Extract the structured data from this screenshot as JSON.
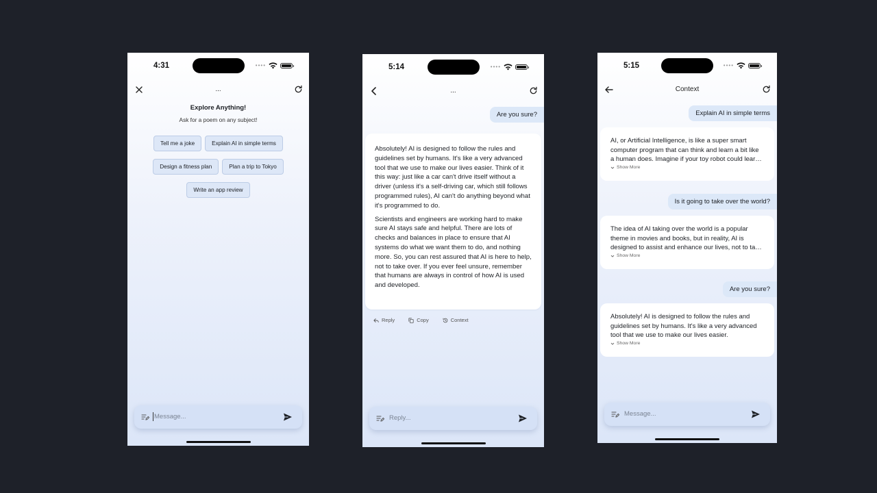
{
  "phone1": {
    "status": {
      "time": "4:31"
    },
    "nav": {
      "title": "..."
    },
    "title": "Explore Anything!",
    "subtitle": "Ask for a poem on any subject!",
    "suggestions": [
      "Tell me a joke",
      "Explain AI in simple terms",
      "Design a fitness plan",
      "Plan a trip to Tokyo",
      "Write an app review"
    ],
    "input": {
      "placeholder": "Message..."
    }
  },
  "phone2": {
    "status": {
      "time": "5:14"
    },
    "nav": {
      "title": "..."
    },
    "user_message": "Are you sure?",
    "assistant_paragraphs": [
      "Absolutely! AI is designed to follow the rules and guidelines set by humans. It's like a very advanced tool that we use to make our lives easier. Think of it this way: just like a car can't drive itself without a driver (unless it's a self-driving car, which still follows programmed rules), AI can't do anything beyond what it's programmed to do.",
      "Scientists and engineers are working hard to make sure AI stays safe and helpful. There are lots of checks and balances in place to ensure that AI systems do what we want them to do, and nothing more. So, you can rest assured that AI is here to help, not to take over. If you ever feel unsure, remember that humans are always in control of how AI is used and developed."
    ],
    "actions": {
      "reply": "Reply",
      "copy": "Copy",
      "context": "Context"
    },
    "input": {
      "placeholder": "Reply..."
    }
  },
  "phone3": {
    "status": {
      "time": "5:15"
    },
    "nav": {
      "title": "Context"
    },
    "thread": [
      {
        "user": "Explain AI in simple terms",
        "assistant": "AI, or Artificial Intelligence, is like a super smart computer program that can think and learn a bit like a human does. Imagine if your toy robot could learn new tricks all by itself."
      },
      {
        "user": "Is it going to take over the world?",
        "assistant": "The idea of AI taking over the world is a popular theme in movies and books, but in reality, AI is designed to assist and enhance our lives, not to take over."
      },
      {
        "user": "Are you sure?",
        "assistant": "Absolutely! AI is designed to follow the rules and guidelines set by humans. It's like a very advanced tool that we use to make our lives easier."
      }
    ],
    "show_more": "Show More",
    "input": {
      "placeholder": "Message..."
    }
  }
}
